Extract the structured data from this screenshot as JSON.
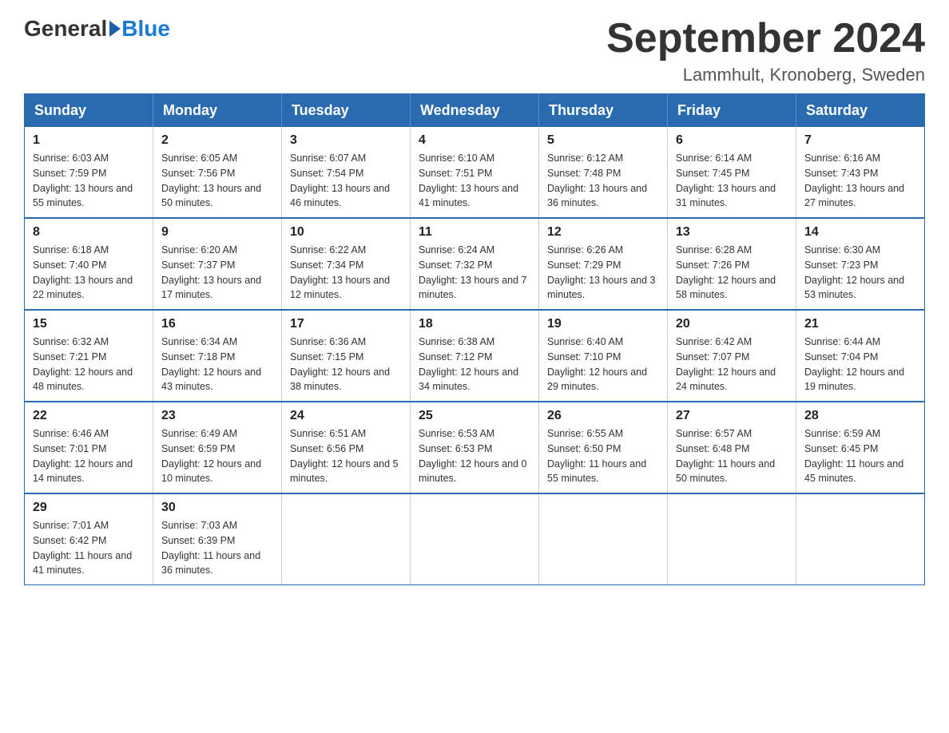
{
  "logo": {
    "text_general": "General",
    "text_blue": "Blue"
  },
  "title": {
    "month_year": "September 2024",
    "location": "Lammhult, Kronoberg, Sweden"
  },
  "weekdays": [
    "Sunday",
    "Monday",
    "Tuesday",
    "Wednesday",
    "Thursday",
    "Friday",
    "Saturday"
  ],
  "weeks": [
    [
      {
        "day": "1",
        "sunrise": "6:03 AM",
        "sunset": "7:59 PM",
        "daylight": "13 hours and 55 minutes."
      },
      {
        "day": "2",
        "sunrise": "6:05 AM",
        "sunset": "7:56 PM",
        "daylight": "13 hours and 50 minutes."
      },
      {
        "day": "3",
        "sunrise": "6:07 AM",
        "sunset": "7:54 PM",
        "daylight": "13 hours and 46 minutes."
      },
      {
        "day": "4",
        "sunrise": "6:10 AM",
        "sunset": "7:51 PM",
        "daylight": "13 hours and 41 minutes."
      },
      {
        "day": "5",
        "sunrise": "6:12 AM",
        "sunset": "7:48 PM",
        "daylight": "13 hours and 36 minutes."
      },
      {
        "day": "6",
        "sunrise": "6:14 AM",
        "sunset": "7:45 PM",
        "daylight": "13 hours and 31 minutes."
      },
      {
        "day": "7",
        "sunrise": "6:16 AM",
        "sunset": "7:43 PM",
        "daylight": "13 hours and 27 minutes."
      }
    ],
    [
      {
        "day": "8",
        "sunrise": "6:18 AM",
        "sunset": "7:40 PM",
        "daylight": "13 hours and 22 minutes."
      },
      {
        "day": "9",
        "sunrise": "6:20 AM",
        "sunset": "7:37 PM",
        "daylight": "13 hours and 17 minutes."
      },
      {
        "day": "10",
        "sunrise": "6:22 AM",
        "sunset": "7:34 PM",
        "daylight": "13 hours and 12 minutes."
      },
      {
        "day": "11",
        "sunrise": "6:24 AM",
        "sunset": "7:32 PM",
        "daylight": "13 hours and 7 minutes."
      },
      {
        "day": "12",
        "sunrise": "6:26 AM",
        "sunset": "7:29 PM",
        "daylight": "13 hours and 3 minutes."
      },
      {
        "day": "13",
        "sunrise": "6:28 AM",
        "sunset": "7:26 PM",
        "daylight": "12 hours and 58 minutes."
      },
      {
        "day": "14",
        "sunrise": "6:30 AM",
        "sunset": "7:23 PM",
        "daylight": "12 hours and 53 minutes."
      }
    ],
    [
      {
        "day": "15",
        "sunrise": "6:32 AM",
        "sunset": "7:21 PM",
        "daylight": "12 hours and 48 minutes."
      },
      {
        "day": "16",
        "sunrise": "6:34 AM",
        "sunset": "7:18 PM",
        "daylight": "12 hours and 43 minutes."
      },
      {
        "day": "17",
        "sunrise": "6:36 AM",
        "sunset": "7:15 PM",
        "daylight": "12 hours and 38 minutes."
      },
      {
        "day": "18",
        "sunrise": "6:38 AM",
        "sunset": "7:12 PM",
        "daylight": "12 hours and 34 minutes."
      },
      {
        "day": "19",
        "sunrise": "6:40 AM",
        "sunset": "7:10 PM",
        "daylight": "12 hours and 29 minutes."
      },
      {
        "day": "20",
        "sunrise": "6:42 AM",
        "sunset": "7:07 PM",
        "daylight": "12 hours and 24 minutes."
      },
      {
        "day": "21",
        "sunrise": "6:44 AM",
        "sunset": "7:04 PM",
        "daylight": "12 hours and 19 minutes."
      }
    ],
    [
      {
        "day": "22",
        "sunrise": "6:46 AM",
        "sunset": "7:01 PM",
        "daylight": "12 hours and 14 minutes."
      },
      {
        "day": "23",
        "sunrise": "6:49 AM",
        "sunset": "6:59 PM",
        "daylight": "12 hours and 10 minutes."
      },
      {
        "day": "24",
        "sunrise": "6:51 AM",
        "sunset": "6:56 PM",
        "daylight": "12 hours and 5 minutes."
      },
      {
        "day": "25",
        "sunrise": "6:53 AM",
        "sunset": "6:53 PM",
        "daylight": "12 hours and 0 minutes."
      },
      {
        "day": "26",
        "sunrise": "6:55 AM",
        "sunset": "6:50 PM",
        "daylight": "11 hours and 55 minutes."
      },
      {
        "day": "27",
        "sunrise": "6:57 AM",
        "sunset": "6:48 PM",
        "daylight": "11 hours and 50 minutes."
      },
      {
        "day": "28",
        "sunrise": "6:59 AM",
        "sunset": "6:45 PM",
        "daylight": "11 hours and 45 minutes."
      }
    ],
    [
      {
        "day": "29",
        "sunrise": "7:01 AM",
        "sunset": "6:42 PM",
        "daylight": "11 hours and 41 minutes."
      },
      {
        "day": "30",
        "sunrise": "7:03 AM",
        "sunset": "6:39 PM",
        "daylight": "11 hours and 36 minutes."
      },
      null,
      null,
      null,
      null,
      null
    ]
  ]
}
